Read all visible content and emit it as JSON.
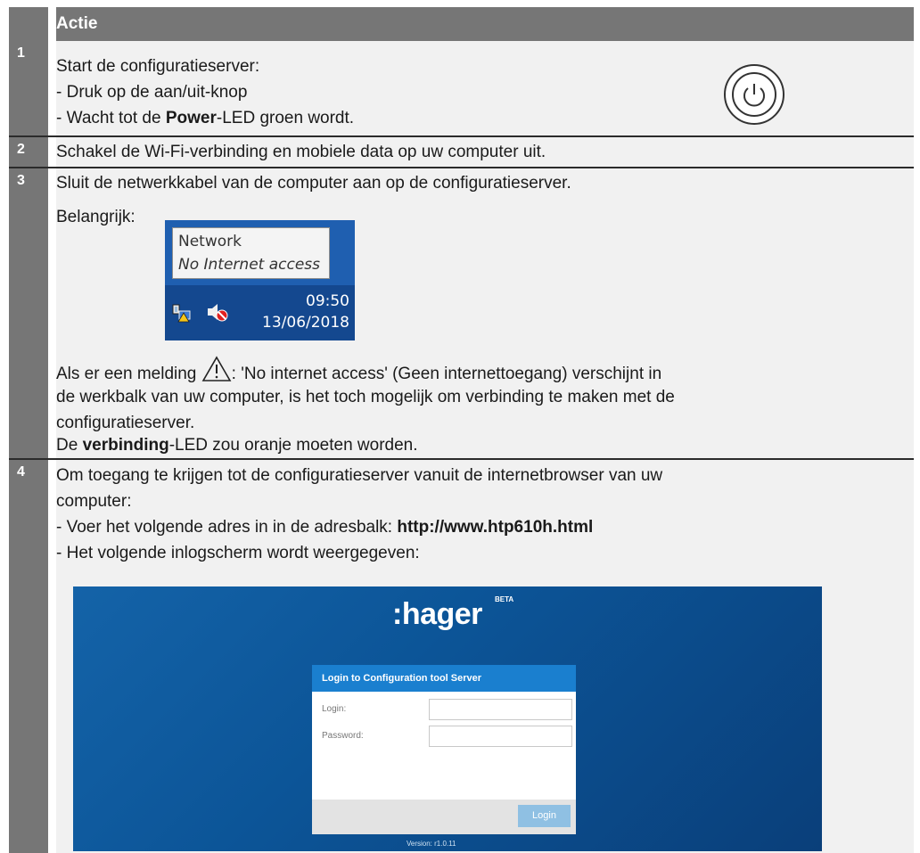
{
  "header": {
    "actie": "Actie"
  },
  "rows": [
    {
      "num": "1",
      "line1": "Start de configuratieserver:",
      "line2": "- Druk op de aan/uit-knop",
      "line3_pre": "- Wacht tot de ",
      "line3_bold": "Power",
      "line3_post": "-LED groen wordt."
    },
    {
      "num": "2",
      "line1": "Schakel de Wi-Fi-verbinding en mobiele data op uw computer uit."
    },
    {
      "num": "3",
      "line1": "Sluit de netwerkkabel van de computer aan op de configuratieserver.",
      "belangrijk": "Belangrijk:",
      "tray": {
        "network": "Network",
        "no_internet": "No Internet access",
        "time": "09:50",
        "date": "13/06/2018"
      },
      "melding_pre": "Als er een melding ",
      "melding_post": ": 'No internet access' (Geen internettoegang) verschijnt in",
      "melding_line2": "de werkbalk van uw computer, is het toch mogelijk om verbinding te maken met de",
      "melding_line3": "configuratieserver.",
      "led_pre": "De ",
      "led_bold": "verbinding",
      "led_post": "-LED zou oranje moeten worden."
    },
    {
      "num": "4",
      "line1": "Om toegang te krijgen tot de configuratieserver vanuit de internetbrowser van uw",
      "line2": "computer:",
      "line3_pre": "- Voer het volgende adres in in de adresbalk: ",
      "line3_bold": "http://www.htp610h.html",
      "line4": "- Het volgende inlogscherm wordt weergegeven:"
    }
  ],
  "login_screen": {
    "logo": ":hager",
    "beta": "BETA",
    "panel_title": "Login to Configuration tool Server",
    "login_label": "Login:",
    "password_label": "Password:",
    "login_button": "Login",
    "version": "Version: r1.0.11"
  },
  "colors": {
    "num_column": "#767676",
    "body_background": "#f1f1f1",
    "login_bg": "#0c5598",
    "panel_header": "#1a7fcf"
  }
}
